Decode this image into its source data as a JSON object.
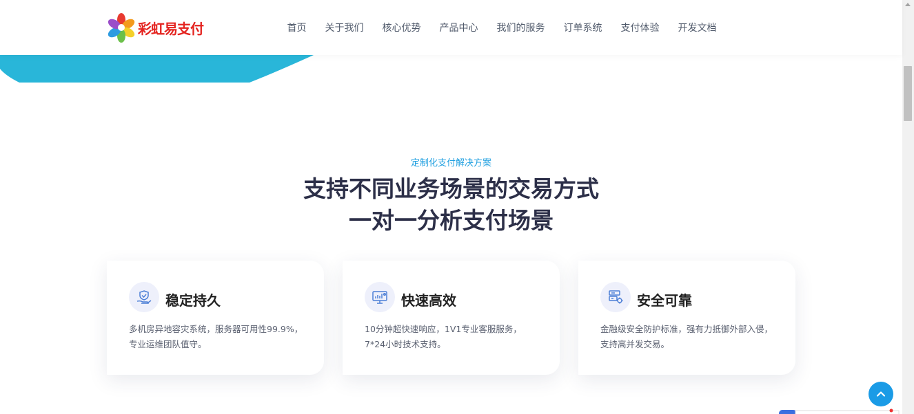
{
  "brand": {
    "logo_text": "彩虹易支付"
  },
  "nav": {
    "items": [
      "首页",
      "关于我们",
      "核心优势",
      "产品中心",
      "我们的服务",
      "订单系统",
      "支付体验",
      "开发文档"
    ]
  },
  "section": {
    "eyebrow": "定制化支付解决方案",
    "title_line1": "支持不同业务场景的交易方式",
    "title_line2": "一对一分析支付场景"
  },
  "cards": [
    {
      "title": "稳定持久",
      "desc_line1": "多机房异地容灾系统，服务器可用性99.9%，",
      "desc_line2": "专业运维团队值守。",
      "icon": "hand-shield-icon"
    },
    {
      "title": "快速高效",
      "desc_line1": "10分钟超快速响应，1V1专业客服服务，",
      "desc_line2": "7*24小时技术支持。",
      "icon": "monitor-chart-icon"
    },
    {
      "title": "安全可靠",
      "desc_line1": "金融级安全防护标准，强有力抵御外部入侵，",
      "desc_line2": "支持高并发交易。",
      "icon": "server-gear-icon"
    }
  ],
  "colors": {
    "accent": "#1e9fe0",
    "hero": "#29b6d9",
    "title": "#2c2f48",
    "logo_red": "#e4231f"
  }
}
